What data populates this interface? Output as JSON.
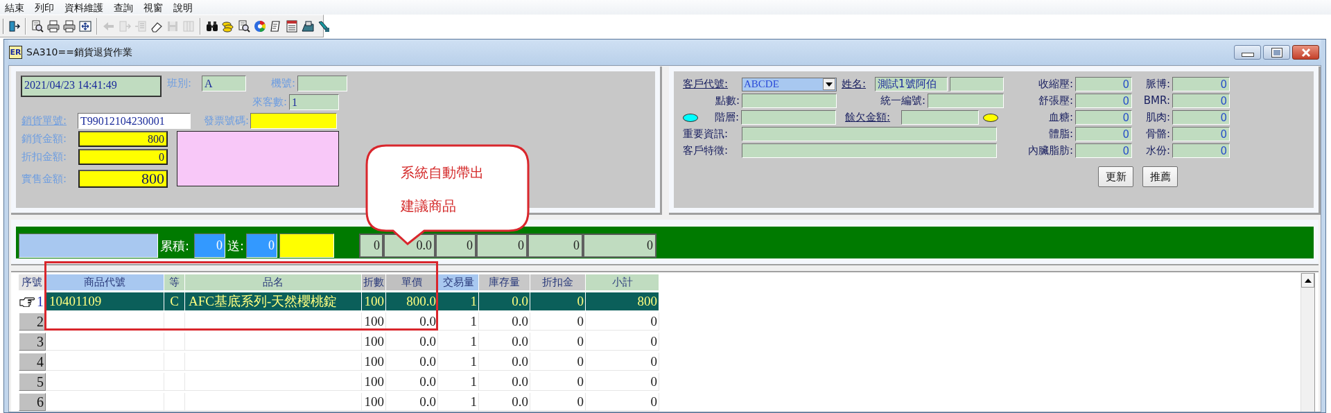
{
  "menu": [
    "結束",
    "列印",
    "資料維護",
    "查詢",
    "視窗",
    "說明"
  ],
  "toolbar": [
    {
      "kind": "exit",
      "disabled": false
    },
    {
      "kind": "separator"
    },
    {
      "kind": "preview",
      "disabled": false
    },
    {
      "kind": "print",
      "disabled": false
    },
    {
      "kind": "print",
      "disabled": false
    },
    {
      "kind": "fit",
      "disabled": false
    },
    {
      "kind": "separator"
    },
    {
      "kind": "back",
      "disabled": true
    },
    {
      "kind": "docnext",
      "disabled": true
    },
    {
      "kind": "list",
      "disabled": true
    },
    {
      "kind": "eraser",
      "disabled": false
    },
    {
      "kind": "save",
      "disabled": true
    },
    {
      "kind": "columns",
      "disabled": true
    },
    {
      "kind": "separator"
    },
    {
      "kind": "binoculars",
      "disabled": false
    },
    {
      "kind": "coins",
      "disabled": false
    },
    {
      "kind": "preview",
      "disabled": false
    },
    {
      "kind": "wheel",
      "disabled": false
    },
    {
      "kind": "note",
      "disabled": false
    },
    {
      "kind": "form",
      "disabled": false
    },
    {
      "kind": "scanner",
      "disabled": false
    },
    {
      "kind": "tool",
      "disabled": false
    }
  ],
  "window": {
    "title": "SA310==銷貨退貨作業",
    "icon_text": "ER"
  },
  "sale_panel": {
    "datetime": "2021/04/23 14:41:49",
    "shift_label": "班別:",
    "shift": "A",
    "machine_label": "機號:",
    "visitors_label": "來客數:",
    "visitors": "1",
    "order_no_label": "銷貨單號:",
    "order_no": "T99012104230001",
    "invoice_label": "發票號碼:",
    "amounts": [
      {
        "label": "銷貨金額:",
        "value": "800",
        "kind": "normal"
      },
      {
        "label": "折扣金額:",
        "value": "0",
        "kind": "normal"
      },
      {
        "label": "實售金額:",
        "value": "800",
        "kind": "large"
      }
    ]
  },
  "customer_panel": {
    "code_label": "客戶代號:",
    "code": "ABCDE",
    "name_label": "姓名:",
    "name": "測試1號阿伯",
    "points_label": "點數:",
    "tax_id_label": "統一編號:",
    "level_label": "階層:",
    "balance_label": "餘欠金額:",
    "important_label": "重要資訊:",
    "trait_label": "客戶特徵:",
    "health": [
      {
        "label": "收縮壓:",
        "value": "0"
      },
      {
        "label": "脈博:",
        "value": "0"
      },
      {
        "label": "舒張壓:",
        "value": "0"
      },
      {
        "label": "BMR:",
        "value": "0"
      },
      {
        "label": "血糖:",
        "value": "0"
      },
      {
        "label": "肌肉:",
        "value": "0"
      },
      {
        "label": "體脂:",
        "value": "0"
      },
      {
        "label": "骨骼:",
        "value": "0"
      },
      {
        "label": "內臟脂肪:",
        "value": "0"
      },
      {
        "label": "水份:",
        "value": "0"
      }
    ],
    "buttons": [
      "更新",
      "推薦"
    ]
  },
  "totals_bar": {
    "accum_label": "累積:",
    "accum": "0",
    "gift_label": "送:",
    "gift": "0",
    "totals": [
      "0",
      "0.0",
      "0",
      "0",
      "0",
      "0"
    ]
  },
  "table": {
    "columns": [
      {
        "label": "序號",
        "color": "#e4e4e4"
      },
      {
        "label": "商品代號",
        "color": "#a8c8f0"
      },
      {
        "label": "等",
        "color": "#c0dcc0"
      },
      {
        "label": "品名",
        "color": "#c0dcc0"
      },
      {
        "label": "折數",
        "color": "#c0c0c0"
      },
      {
        "label": "單價",
        "color": "#c0c0c0"
      },
      {
        "label": "交易量",
        "color": "#a8c8f0"
      },
      {
        "label": "庫存量",
        "color": "#c8c8c8"
      },
      {
        "label": "折扣金",
        "color": "#c8c8c8"
      },
      {
        "label": "小計",
        "color": "#c0dcc0"
      }
    ],
    "rows": [
      {
        "no": "1",
        "selected": true,
        "code": "10401109",
        "grade": "C",
        "name": "AFC基底系列-天然櫻桃錠",
        "discount": "100",
        "price": "800.0",
        "qty": "1",
        "stock": "0.0",
        "disc_amount": "0",
        "subtotal": "800"
      },
      {
        "no": "2",
        "selected": false,
        "discount": "100",
        "price": "0.0",
        "qty": "1",
        "stock": "0.0",
        "disc_amount": "0",
        "subtotal": "0"
      },
      {
        "no": "3",
        "selected": false,
        "discount": "100",
        "price": "0.0",
        "qty": "1",
        "stock": "0.0",
        "disc_amount": "0",
        "subtotal": "0"
      },
      {
        "no": "4",
        "selected": false,
        "discount": "100",
        "price": "0.0",
        "qty": "1",
        "stock": "0.0",
        "disc_amount": "0",
        "subtotal": "0"
      },
      {
        "no": "5",
        "selected": false,
        "discount": "100",
        "price": "0.0",
        "qty": "1",
        "stock": "0.0",
        "disc_amount": "0",
        "subtotal": "0"
      },
      {
        "no": "6",
        "selected": false,
        "discount": "100",
        "price": "0.0",
        "qty": "1",
        "stock": "0.0",
        "disc_amount": "0",
        "subtotal": "0"
      }
    ]
  },
  "annotation": {
    "callout": [
      "系統自動帶出",
      "建議商品"
    ]
  }
}
